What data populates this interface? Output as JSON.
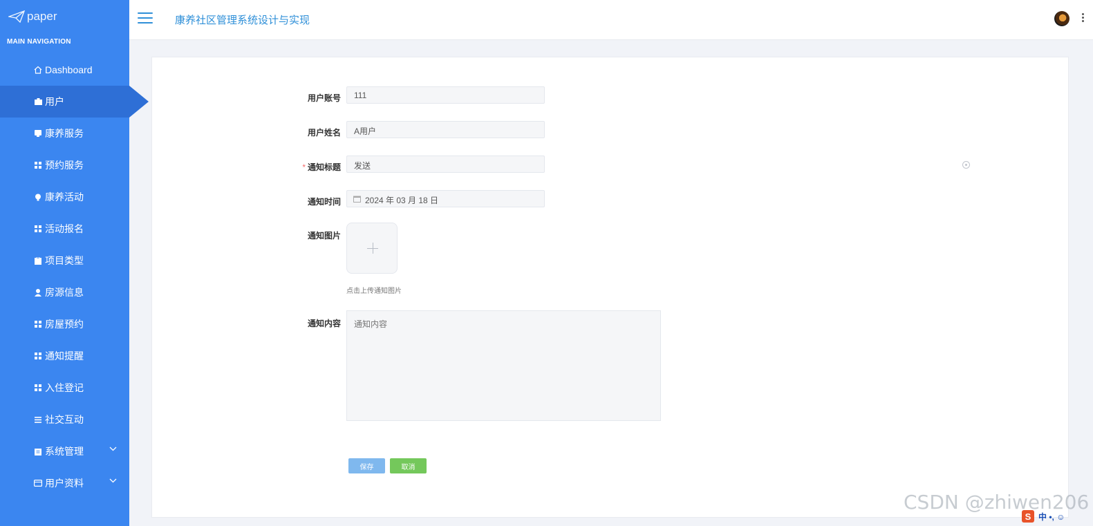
{
  "sidebar": {
    "brand": "paper",
    "heading": "MAIN NAVIGATION",
    "items": [
      {
        "label": "Dashboard",
        "icon": "home-icon"
      },
      {
        "label": "用户",
        "icon": "briefcase-icon"
      },
      {
        "label": "康养服务",
        "icon": "bookmark-icon"
      },
      {
        "label": "预约服务",
        "icon": "grid-icon"
      },
      {
        "label": "康养活动",
        "icon": "bulb-icon"
      },
      {
        "label": "活动报名",
        "icon": "grid-icon"
      },
      {
        "label": "项目类型",
        "icon": "clipboard-icon"
      },
      {
        "label": "房源信息",
        "icon": "user-icon"
      },
      {
        "label": "房屋预约",
        "icon": "grid-icon"
      },
      {
        "label": "通知提醒",
        "icon": "grid-icon"
      },
      {
        "label": "入住登记",
        "icon": "grid-icon"
      },
      {
        "label": "社交互动",
        "icon": "list-icon"
      },
      {
        "label": "系统管理",
        "icon": "clipboard-icon"
      },
      {
        "label": "用户资料",
        "icon": "card-icon"
      }
    ]
  },
  "header": {
    "title": "康养社区管理系统设计与实现"
  },
  "form": {
    "account_label": "用户账号",
    "account_value": "111",
    "name_label": "用户姓名",
    "name_value": "A用户",
    "required_mark": "*",
    "title_label": "通知标题",
    "title_value": "发送",
    "time_label": "通知时间",
    "time_value": "2024 年 03 月 18 日",
    "image_label": "通知图片",
    "image_hint": "点击上传通知图片",
    "content_label": "通知内容",
    "content_placeholder": "通知内容",
    "save_label": "保存",
    "cancel_label": "取消"
  },
  "overlay": {
    "watermark": "CSDN @zhiwen206",
    "ime_text": "中 •, ☺"
  },
  "colors": {
    "sidebar": "#3b86f0",
    "sidebar_active": "#2e6fd6",
    "title_blue": "#2e8fd8",
    "save": "#7fb8ee",
    "cancel": "#74c85b"
  }
}
